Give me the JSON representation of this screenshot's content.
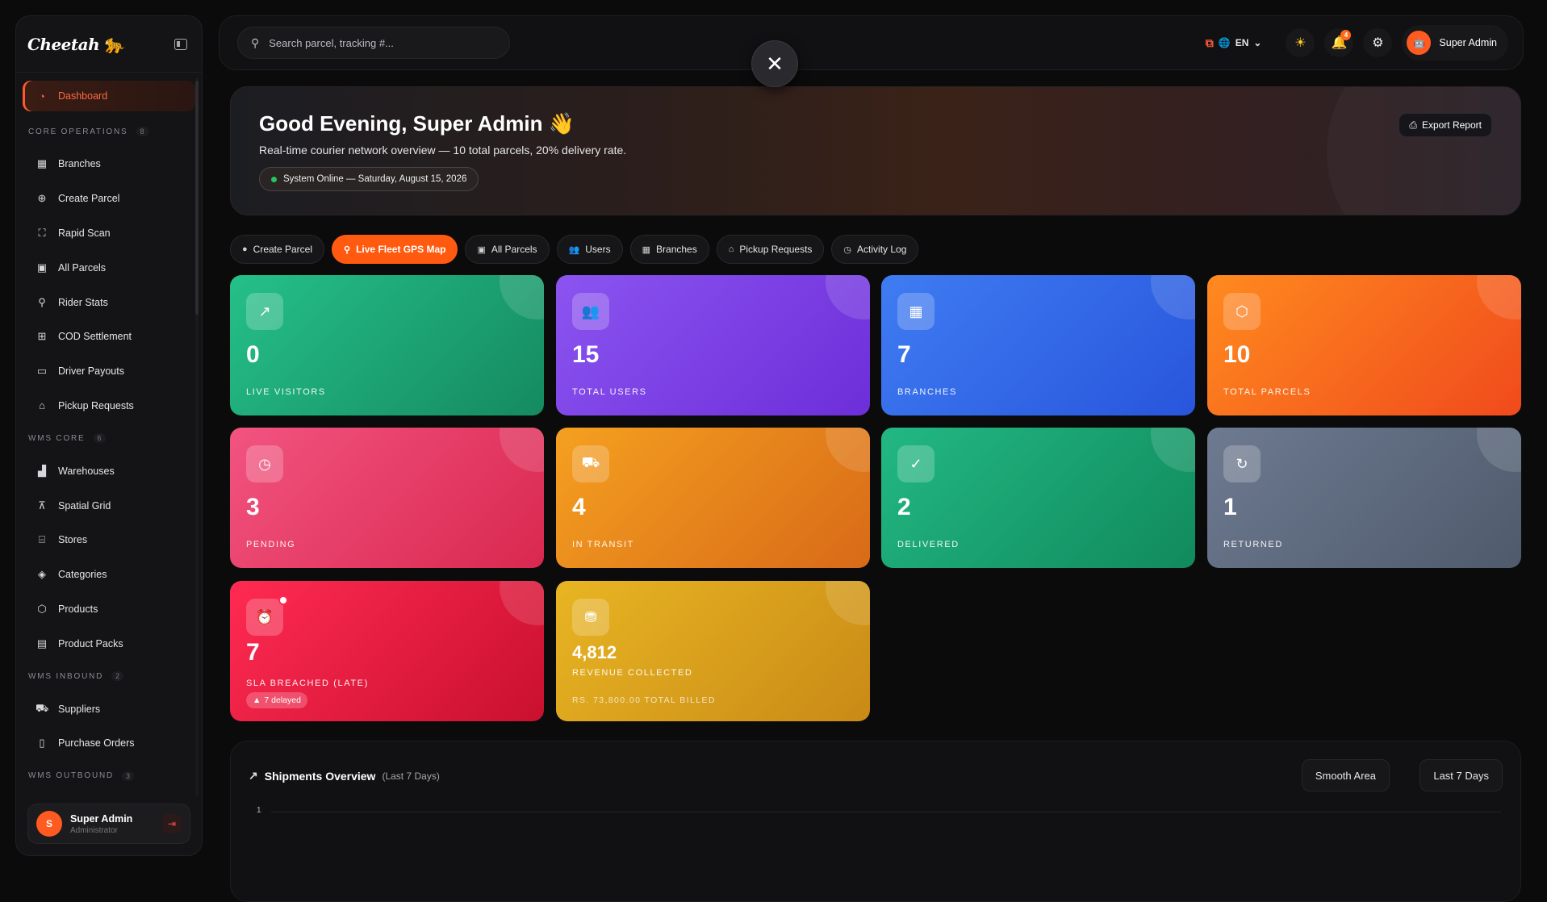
{
  "brand": {
    "name": "Cheetah"
  },
  "sidebar": {
    "active": {
      "label": "Dashboard"
    },
    "sections": [
      {
        "title": "CORE OPERATIONS",
        "count": "8",
        "items": [
          {
            "label": "Branches"
          },
          {
            "label": "Create Parcel"
          },
          {
            "label": "Rapid Scan"
          },
          {
            "label": "All Parcels"
          },
          {
            "label": "Rider Stats"
          },
          {
            "label": "COD Settlement"
          },
          {
            "label": "Driver Payouts"
          },
          {
            "label": "Pickup Requests"
          }
        ]
      },
      {
        "title": "WMS CORE",
        "count": "6",
        "items": [
          {
            "label": "Warehouses"
          },
          {
            "label": "Spatial Grid"
          },
          {
            "label": "Stores"
          },
          {
            "label": "Categories"
          },
          {
            "label": "Products"
          },
          {
            "label": "Product Packs"
          }
        ]
      },
      {
        "title": "WMS INBOUND",
        "count": "2",
        "items": [
          {
            "label": "Suppliers"
          },
          {
            "label": "Purchase Orders"
          }
        ]
      },
      {
        "title": "WMS OUTBOUND",
        "count": "3",
        "items": []
      }
    ],
    "user": {
      "initial": "S",
      "name": "Super Admin",
      "role": "Administrator"
    }
  },
  "topbar": {
    "search_placeholder": "Search parcel, tracking #...",
    "language": "EN",
    "notifications_count": "4",
    "profile_name": "Super Admin"
  },
  "hero": {
    "greeting": "Good Evening, Super Admin 👋",
    "subtitle": "Real-time courier network overview — 10 total parcels, 20% delivery rate.",
    "status": "System Online — Saturday, August 15, 2026",
    "export_label": "Export Report"
  },
  "tabs": [
    {
      "label": "Create Parcel",
      "icon": "plus-circle-icon"
    },
    {
      "label": "Live Fleet GPS Map",
      "icon": "map-pin-icon"
    },
    {
      "label": "All Parcels",
      "icon": "box-icon"
    },
    {
      "label": "Users",
      "icon": "users-icon"
    },
    {
      "label": "Branches",
      "icon": "building-icon"
    },
    {
      "label": "Pickup Requests",
      "icon": "home-icon"
    },
    {
      "label": "Activity Log",
      "icon": "clock-icon"
    }
  ],
  "stats": [
    {
      "value": "0",
      "label": "LIVE VISITORS",
      "icon": "trend-icon"
    },
    {
      "value": "15",
      "label": "TOTAL USERS",
      "icon": "users-icon"
    },
    {
      "value": "7",
      "label": "BRANCHES",
      "icon": "building-icon"
    },
    {
      "value": "10",
      "label": "TOTAL PARCELS",
      "icon": "box-icon"
    },
    {
      "value": "3",
      "label": "PENDING",
      "icon": "clock-icon"
    },
    {
      "value": "4",
      "label": "IN TRANSIT",
      "icon": "truck-icon"
    },
    {
      "value": "2",
      "label": "DELIVERED",
      "icon": "check-icon"
    },
    {
      "value": "1",
      "label": "RETURNED",
      "icon": "return-icon"
    },
    {
      "value": "7",
      "label": "SLA BREACHED (LATE)",
      "icon": "alarm-icon",
      "pill": "7 delayed"
    },
    {
      "value": "4,812",
      "label": "REVENUE COLLECTED",
      "icon": "coins-icon",
      "sub": "RS. 73,800.00 TOTAL BILLED"
    }
  ],
  "chart": {
    "title": "Shipments Overview",
    "range": "(Last 7 Days)",
    "style_label": "Smooth Area",
    "period_label": "Last 7 Days",
    "y_top": "1"
  },
  "colors": {
    "accent": "#ff5a0f",
    "online": "#22c55e"
  }
}
